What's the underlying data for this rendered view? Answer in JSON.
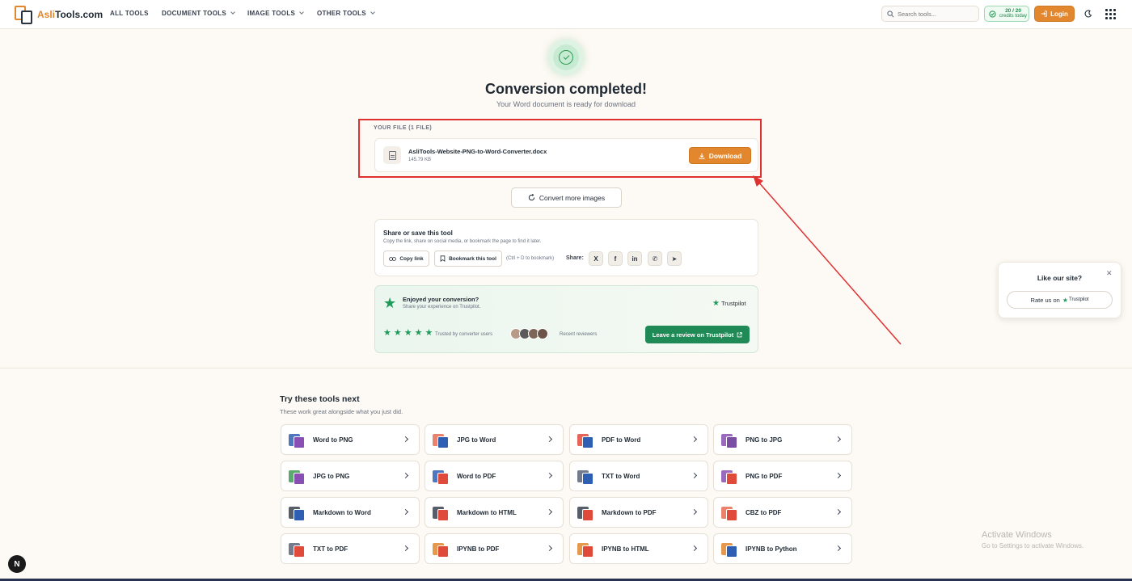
{
  "nav": {
    "logo_main": "Asli",
    "logo_rest": "Tools.com",
    "links": [
      "ALL TOOLS",
      "DOCUMENT TOOLS",
      "IMAGE TOOLS",
      "OTHER TOOLS"
    ],
    "search_placeholder": "Search tools...",
    "credits_count": "20 / 20",
    "credits_label": "credits today",
    "login_label": "Login"
  },
  "result": {
    "title": "Conversion completed!",
    "subtitle": "Your Word document is ready for download",
    "files_heading": "YOUR FILE (1 FILE)",
    "file_name": "AsliTools-Website-PNG-to-Word-Converter.docx",
    "file_size": "145.79 KB",
    "download_label": "Download",
    "convert_more_label": "Convert more images"
  },
  "share": {
    "title": "Share or save this tool",
    "subtitle": "Copy the link, share on social media, or bookmark the page to find it later.",
    "copy_label": "Copy link",
    "bookmark_label": "Bookmark this tool",
    "shortcut_hint": "(Ctrl + D to bookmark)",
    "share_label": "Share:",
    "social": [
      "X",
      "f",
      "in",
      "✆",
      "➤"
    ]
  },
  "trustpilot": {
    "title": "Enjoyed your conversion?",
    "subtitle": "Share your experience on Trustpilot.",
    "brand": "Trustpilot",
    "trusted_label": "Trusted by converter users",
    "recent_label": "Recent reviewers",
    "review_button": "Leave a review on Trustpilot"
  },
  "tools": {
    "title": "Try these tools next",
    "subtitle": "These work great alongside what you just did.",
    "items": [
      {
        "label": "Word to PNG",
        "back": "#2f5fb3",
        "front": "#8a4fb3"
      },
      {
        "label": "JPG to Word",
        "back": "#e76d52",
        "front": "#2f5fb3"
      },
      {
        "label": "PDF to Word",
        "back": "#e04a3a",
        "front": "#2f5fb3"
      },
      {
        "label": "PNG to JPG",
        "back": "#8a4fb3",
        "front": "#7a4fa3"
      },
      {
        "label": "JPG to PNG",
        "back": "#3f9a55",
        "front": "#8a4fb3"
      },
      {
        "label": "Word to PDF",
        "back": "#2f5fb3",
        "front": "#e04a3a"
      },
      {
        "label": "TXT to Word",
        "back": "#5a6478",
        "front": "#2f5fb3"
      },
      {
        "label": "PNG to PDF",
        "back": "#8a4fb3",
        "front": "#e04a3a"
      },
      {
        "label": "Markdown to Word",
        "back": "#3a4250",
        "front": "#2f5fb3"
      },
      {
        "label": "Markdown to HTML",
        "back": "#3a4250",
        "front": "#e04a3a"
      },
      {
        "label": "Markdown to PDF",
        "back": "#3a4250",
        "front": "#e04a3a"
      },
      {
        "label": "CBZ to PDF",
        "back": "#e76d52",
        "front": "#e04a3a"
      },
      {
        "label": "TXT to PDF",
        "back": "#5a6478",
        "front": "#e04a3a"
      },
      {
        "label": "IPYNB to PDF",
        "back": "#e2872d",
        "front": "#e04a3a"
      },
      {
        "label": "IPYNB to HTML",
        "back": "#e2872d",
        "front": "#e04a3a"
      },
      {
        "label": "IPYNB to Python",
        "back": "#e2872d",
        "front": "#2f5fb3"
      }
    ]
  },
  "like_popup": {
    "title": "Like our site?",
    "rate_label": "Rate us on",
    "brand": "Trustpilot"
  },
  "windows": {
    "line1": "Activate Windows",
    "line2": "Go to Settings to activate Windows."
  },
  "badge": "N",
  "colors": {
    "accent": "#e2872d",
    "success": "#2f9a55",
    "trustpilot": "#1f8a55",
    "annotation": "#e03131"
  }
}
